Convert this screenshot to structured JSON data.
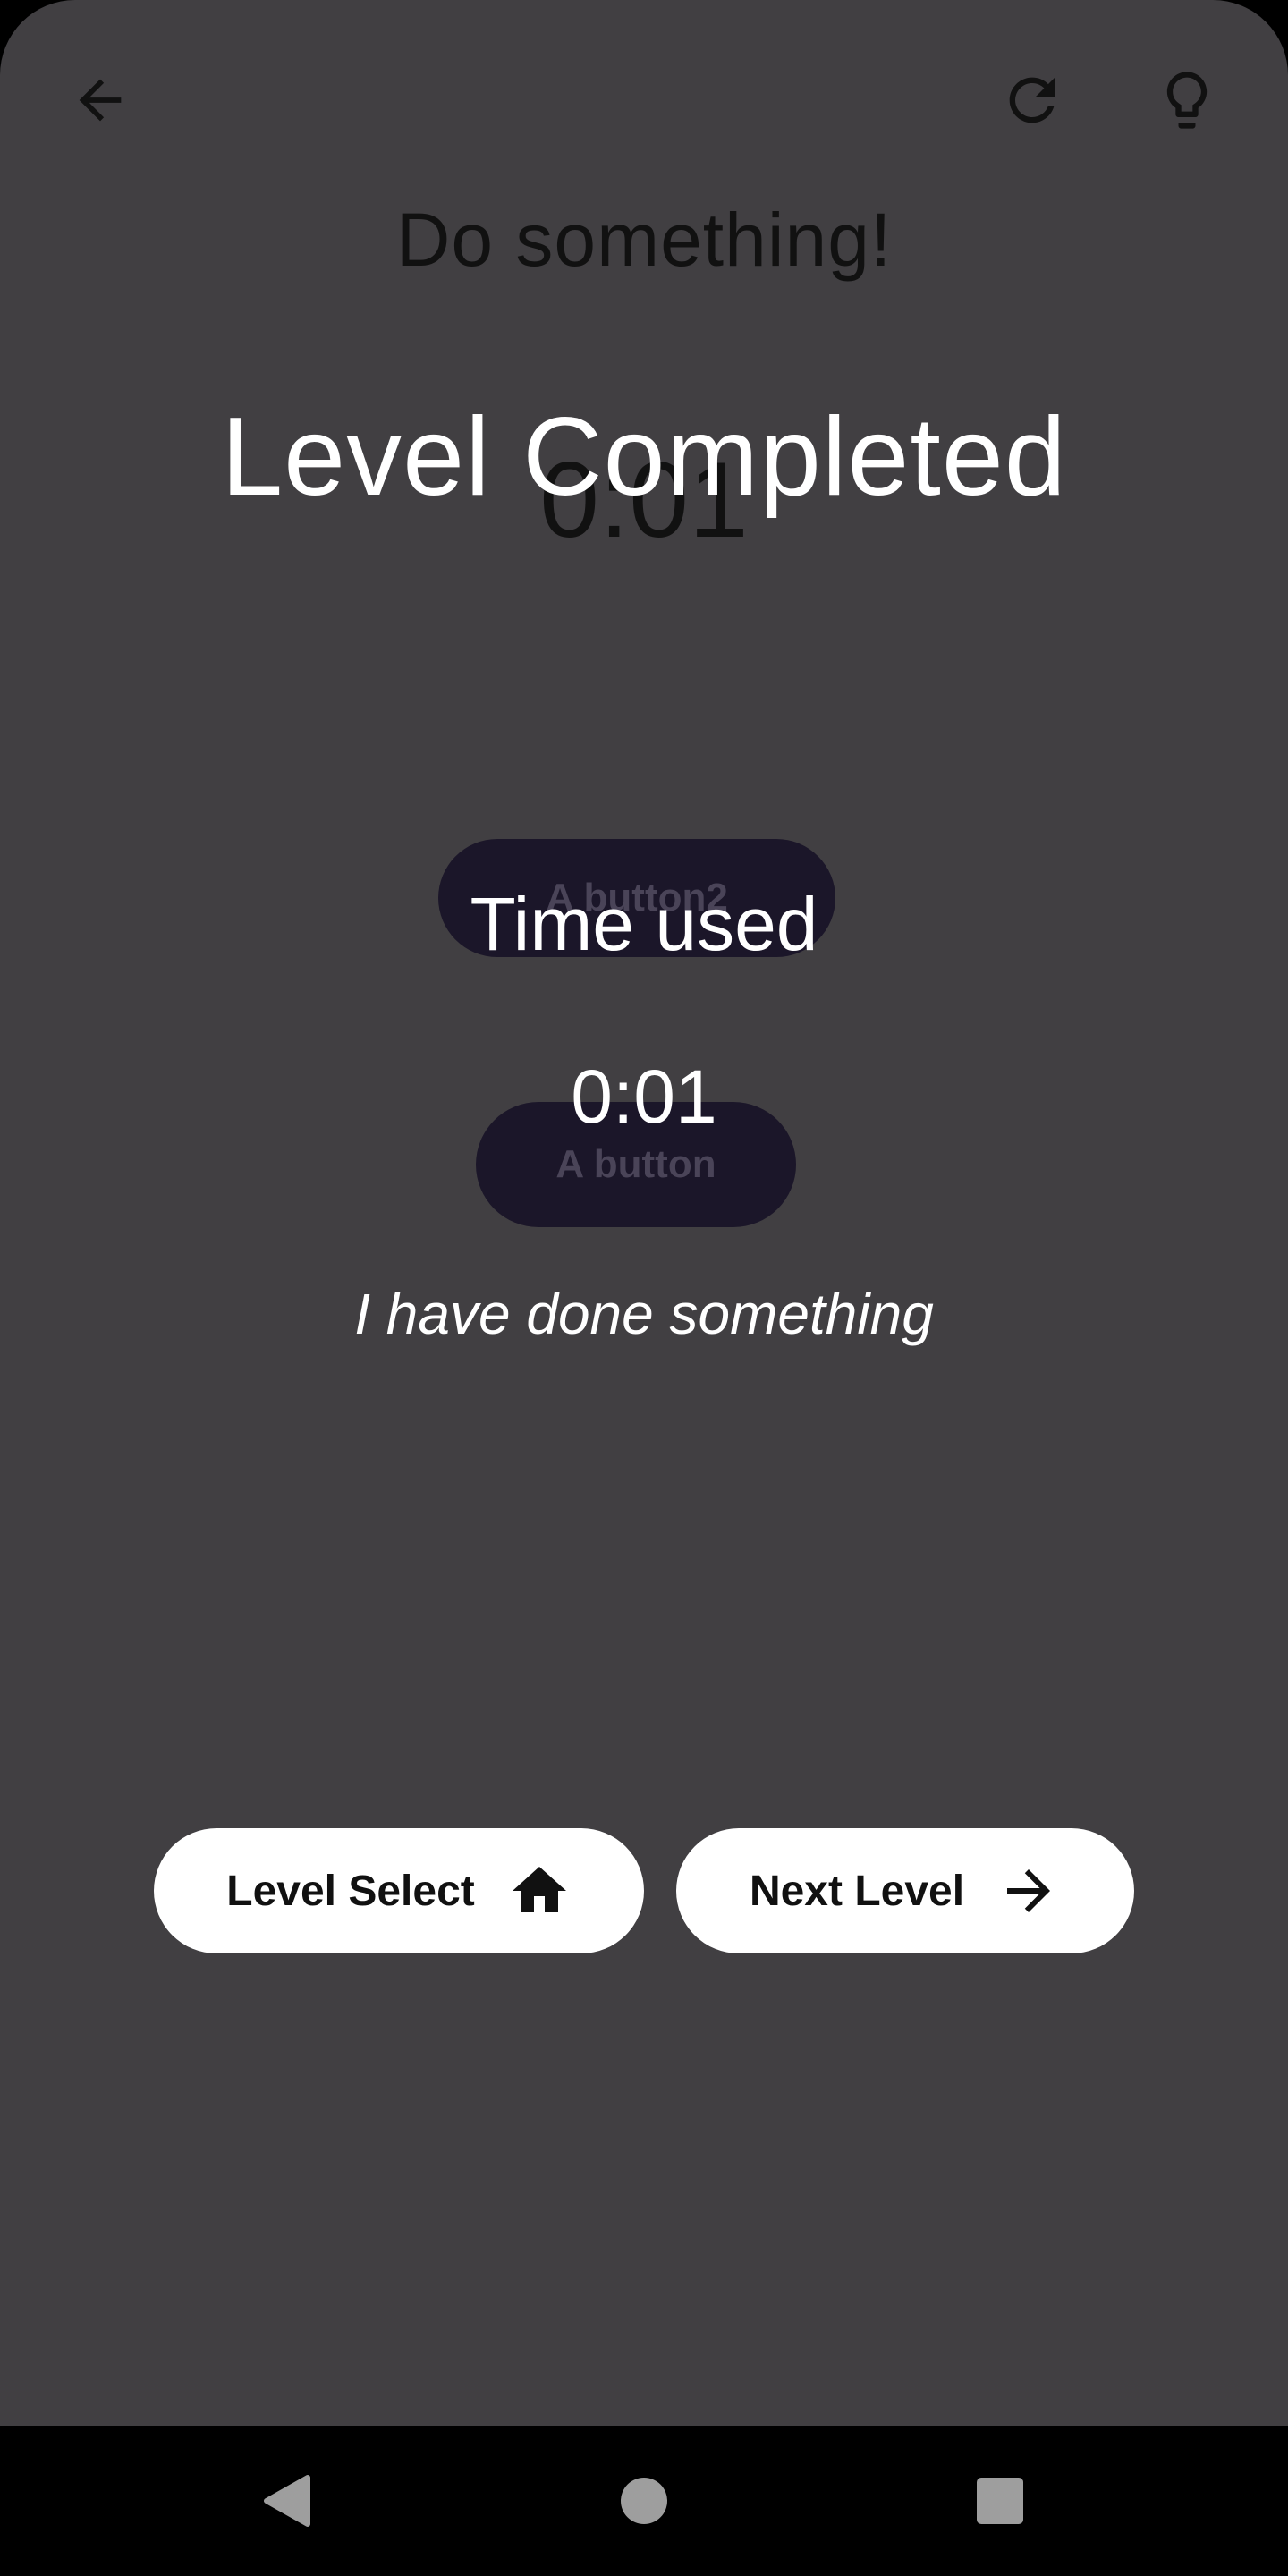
{
  "toolbar": {
    "back_icon": "arrow-left-icon",
    "restart_icon": "refresh-icon",
    "hint_icon": "lightbulb-icon"
  },
  "level": {
    "instruction": "Do something!",
    "timer": "0:01",
    "button2_label": "A button2",
    "button_label": "A button"
  },
  "overlay": {
    "title": "Level Completed",
    "time_label": "Time used",
    "time_value": "0:01",
    "message": "I have done something",
    "level_select_label": "Level Select",
    "level_select_icon": "home-icon",
    "next_level_label": "Next Level",
    "next_level_icon": "arrow-right-icon"
  },
  "system_nav": {
    "back_icon": "nav-back-triangle-icon",
    "home_icon": "nav-home-circle-icon",
    "recents_icon": "nav-recents-square-icon"
  },
  "colors": {
    "dim_background": "#413f42",
    "ghost_button": "#1b1629",
    "pill_background": "#ffffff"
  }
}
